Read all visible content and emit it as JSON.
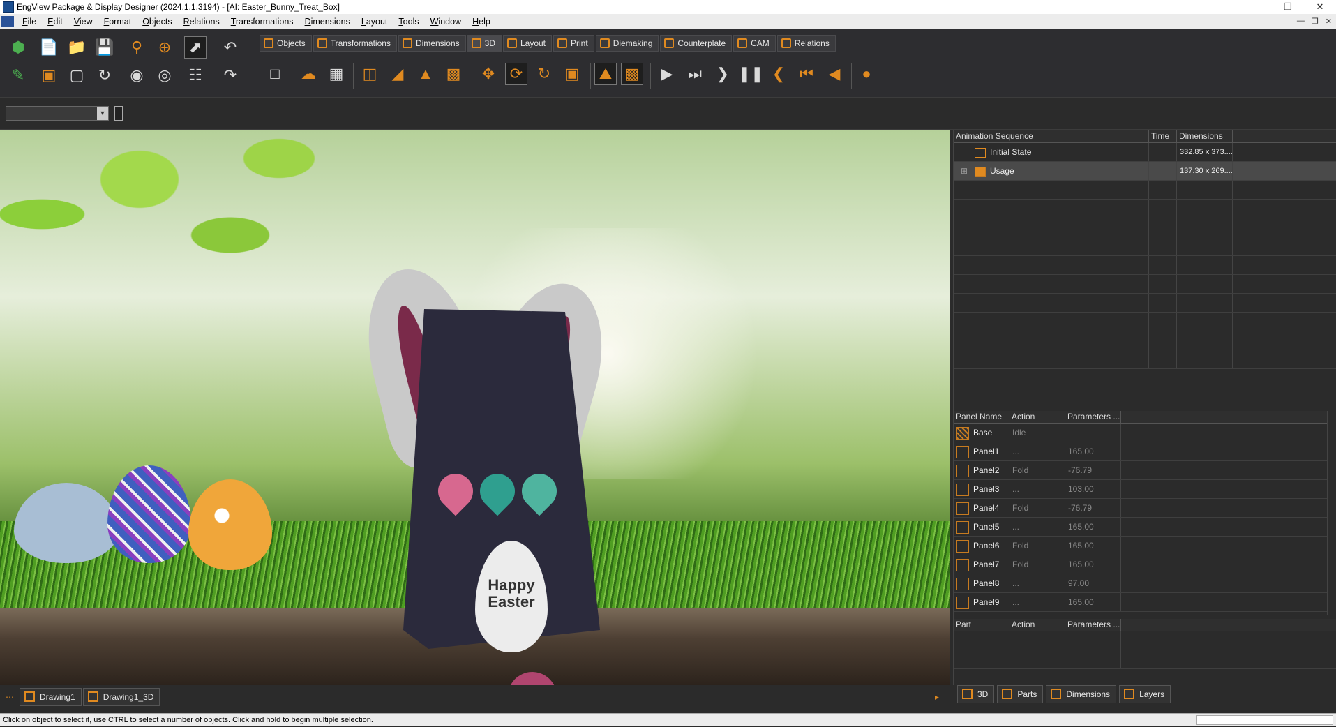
{
  "window": {
    "title": "EngView Package & Display Designer (2024.1.1.3194) - [AI: Easter_Bunny_Treat_Box]"
  },
  "menu": [
    "File",
    "Edit",
    "View",
    "Format",
    "Objects",
    "Relations",
    "Transformations",
    "Dimensions",
    "Layout",
    "Tools",
    "Window",
    "Help"
  ],
  "tabs": [
    {
      "label": "Objects"
    },
    {
      "label": "Transformations"
    },
    {
      "label": "Dimensions"
    },
    {
      "label": "3D"
    },
    {
      "label": "Layout"
    },
    {
      "label": "Print"
    },
    {
      "label": "Diemaking"
    },
    {
      "label": "Counterplate"
    },
    {
      "label": "CAM"
    },
    {
      "label": "Relations"
    }
  ],
  "viewport": {
    "box_text": "Happy Easter"
  },
  "animation": {
    "headers": [
      "Animation Sequence",
      "Time",
      "Dimensions"
    ],
    "rows": [
      {
        "name": "Initial State",
        "time": "",
        "dims": "332.85 x 373...."
      },
      {
        "name": "Usage",
        "time": "",
        "dims": "137.30 x 269...."
      }
    ]
  },
  "panels": {
    "headers": [
      "Panel Name",
      "Action",
      "Parameters ..."
    ],
    "rows": [
      {
        "name": "Base",
        "action": "Idle",
        "param": ""
      },
      {
        "name": "Panel1",
        "action": "...",
        "param": "165.00"
      },
      {
        "name": "Panel2",
        "action": "Fold",
        "param": "-76.79"
      },
      {
        "name": "Panel3",
        "action": "...",
        "param": "103.00"
      },
      {
        "name": "Panel4",
        "action": "Fold",
        "param": "-76.79"
      },
      {
        "name": "Panel5",
        "action": "...",
        "param": "165.00"
      },
      {
        "name": "Panel6",
        "action": "Fold",
        "param": "165.00"
      },
      {
        "name": "Panel7",
        "action": "Fold",
        "param": "165.00"
      },
      {
        "name": "Panel8",
        "action": "...",
        "param": "97.00"
      },
      {
        "name": "Panel9",
        "action": "...",
        "param": "165.00"
      }
    ]
  },
  "parts": {
    "headers": [
      "Part",
      "Action",
      "Parameters ..."
    ]
  },
  "right_tabs": [
    "3D",
    "Parts",
    "Dimensions",
    "Layers"
  ],
  "drawing_tabs": [
    "Drawing1",
    "Drawing1_3D"
  ],
  "status": "Click on object to select it, use CTRL to select a number of objects. Click and hold to begin multiple selection."
}
